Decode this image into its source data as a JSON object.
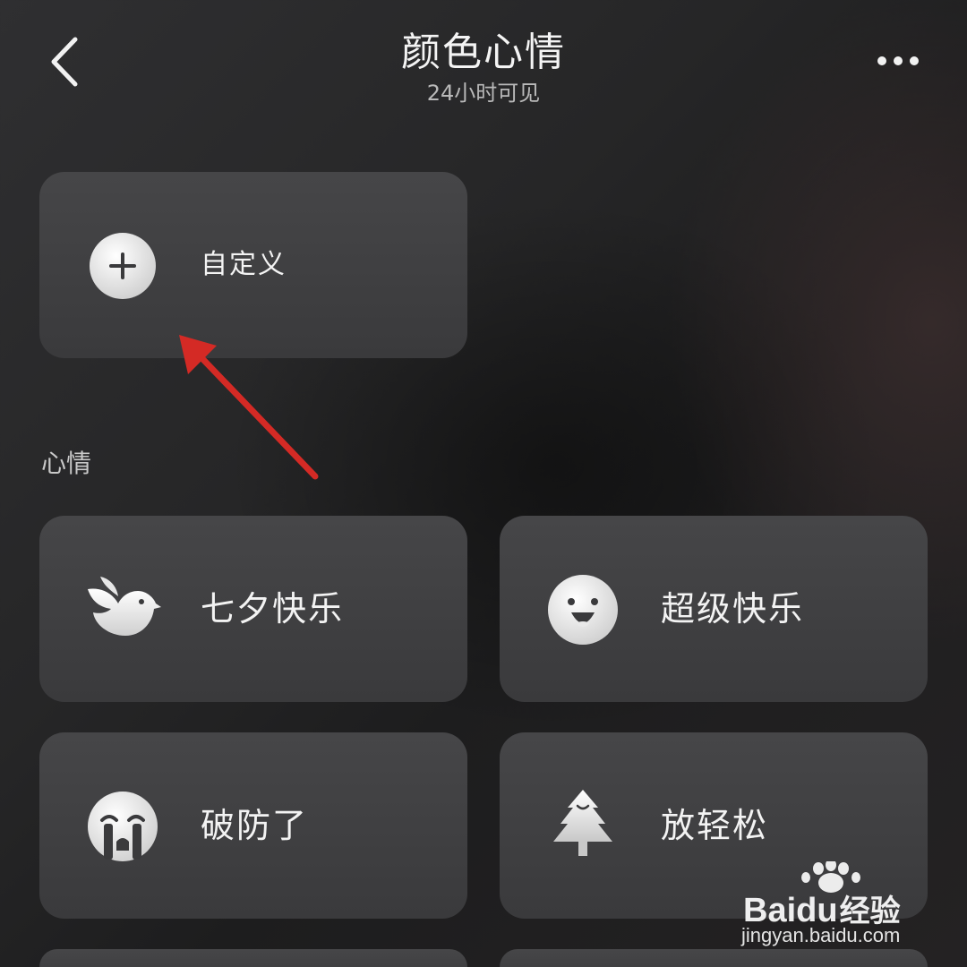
{
  "header": {
    "title": "颜色心情",
    "subtitle": "24小时可见",
    "back_icon": "chevron-left-icon",
    "more_icon": "more-horizontal-icon"
  },
  "custom_card": {
    "label": "自定义",
    "icon": "plus-circle-icon"
  },
  "section": {
    "title": "心情"
  },
  "moods": [
    {
      "label": "七夕快乐",
      "icon": "bird-icon"
    },
    {
      "label": "超级快乐",
      "icon": "laughing-face-icon"
    },
    {
      "label": "破防了",
      "icon": "crying-face-icon"
    },
    {
      "label": "放轻松",
      "icon": "tree-icon"
    }
  ],
  "annotation": {
    "color": "#d42a25",
    "points_to": "custom_card"
  },
  "watermark": {
    "brand_latin": "Bai",
    "brand_latin_2": "du",
    "brand_cn": "经验",
    "url": "jingyan.baidu.com"
  },
  "colors": {
    "background": "#262627",
    "card": "#424244",
    "text": "#f3f3f3",
    "subtle_text": "#b9b9b9"
  }
}
